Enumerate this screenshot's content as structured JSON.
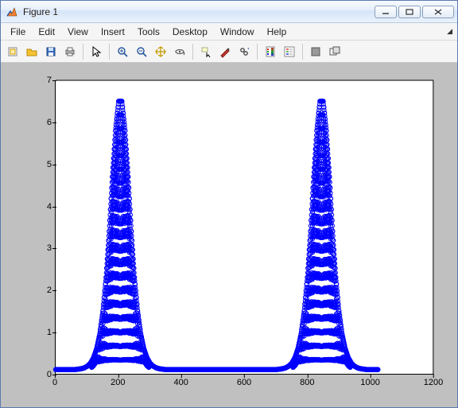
{
  "window": {
    "title": "Figure 1"
  },
  "menu": {
    "items": [
      "File",
      "Edit",
      "View",
      "Insert",
      "Tools",
      "Desktop",
      "Window",
      "Help"
    ]
  },
  "toolbar": {
    "groups": [
      [
        "new-figure",
        "open",
        "save",
        "print"
      ],
      [
        "pointer"
      ],
      [
        "zoom-in",
        "zoom-out",
        "pan",
        "rotate-3d"
      ],
      [
        "data-cursor",
        "brush",
        "link"
      ],
      [
        "colorbar",
        "legend"
      ],
      [
        "hide-tools",
        "show-tools"
      ]
    ],
    "icon_names": {
      "new-figure": "new-figure-icon",
      "open": "open-icon",
      "save": "save-icon",
      "print": "print-icon",
      "pointer": "pointer-icon",
      "zoom-in": "zoom-in-icon",
      "zoom-out": "zoom-out-icon",
      "pan": "pan-icon",
      "rotate-3d": "rotate-3d-icon",
      "data-cursor": "data-cursor-icon",
      "brush": "brush-icon",
      "link": "link-icon",
      "colorbar": "colorbar-icon",
      "legend": "legend-icon",
      "hide-tools": "hide-tools-icon",
      "show-tools": "show-tools-icon"
    }
  },
  "colors": {
    "series": "#0000ff",
    "axes_bg": "#ffffff",
    "figure_bg": "#c0c0c0"
  },
  "chart_data": {
    "type": "scatter",
    "marker": "circle",
    "series_color": "#0000ff",
    "xlim": [
      0,
      1200
    ],
    "ylim": [
      0,
      7
    ],
    "xticks": [
      0,
      200,
      400,
      600,
      800,
      1000,
      1200
    ],
    "yticks": [
      0,
      1,
      2,
      3,
      4,
      5,
      6,
      7
    ],
    "title": "",
    "xlabel": "",
    "ylabel": "",
    "data_description": "Two Gaussian-like peaks at x≈200 and x≈830, peak height≈6.5, baseline≈0.1, domain roughly 0–1024",
    "x": [
      0,
      10,
      20,
      30,
      40,
      50,
      60,
      70,
      80,
      90,
      100,
      110,
      120,
      130,
      140,
      150,
      160,
      170,
      180,
      190,
      200,
      210,
      220,
      230,
      240,
      250,
      260,
      270,
      280,
      290,
      300,
      310,
      320,
      330,
      340,
      350,
      360,
      370,
      380,
      390,
      400,
      410,
      420,
      430,
      440,
      450,
      460,
      470,
      480,
      490,
      500,
      510,
      520,
      530,
      540,
      550,
      560,
      570,
      580,
      590,
      600,
      610,
      620,
      630,
      640,
      650,
      660,
      670,
      680,
      690,
      700,
      710,
      720,
      730,
      740,
      750,
      760,
      770,
      780,
      790,
      800,
      810,
      820,
      830,
      840,
      850,
      860,
      870,
      880,
      890,
      900,
      910,
      920,
      930,
      940,
      950,
      960,
      970,
      980,
      990,
      1000,
      1010,
      1020,
      1024
    ],
    "y": [
      0.1,
      0.1,
      0.1,
      0.1,
      0.1,
      0.1,
      0.1,
      0.11,
      0.12,
      0.14,
      0.18,
      0.25,
      0.38,
      0.6,
      0.95,
      1.5,
      2.3,
      3.4,
      4.7,
      5.8,
      6.5,
      6.5,
      5.8,
      4.7,
      3.4,
      2.3,
      1.5,
      0.95,
      0.6,
      0.38,
      0.25,
      0.18,
      0.14,
      0.12,
      0.11,
      0.1,
      0.1,
      0.1,
      0.1,
      0.1,
      0.1,
      0.1,
      0.1,
      0.1,
      0.1,
      0.1,
      0.1,
      0.1,
      0.1,
      0.1,
      0.1,
      0.1,
      0.1,
      0.1,
      0.1,
      0.1,
      0.1,
      0.1,
      0.1,
      0.1,
      0.1,
      0.1,
      0.1,
      0.1,
      0.1,
      0.1,
      0.1,
      0.1,
      0.1,
      0.1,
      0.1,
      0.11,
      0.12,
      0.14,
      0.18,
      0.25,
      0.38,
      0.6,
      0.95,
      1.5,
      2.3,
      3.4,
      4.7,
      5.8,
      6.5,
      6.5,
      5.8,
      4.7,
      3.4,
      2.3,
      1.5,
      0.95,
      0.6,
      0.38,
      0.25,
      0.18,
      0.14,
      0.12,
      0.11,
      0.1,
      0.1,
      0.1,
      0.1,
      0.1
    ]
  }
}
